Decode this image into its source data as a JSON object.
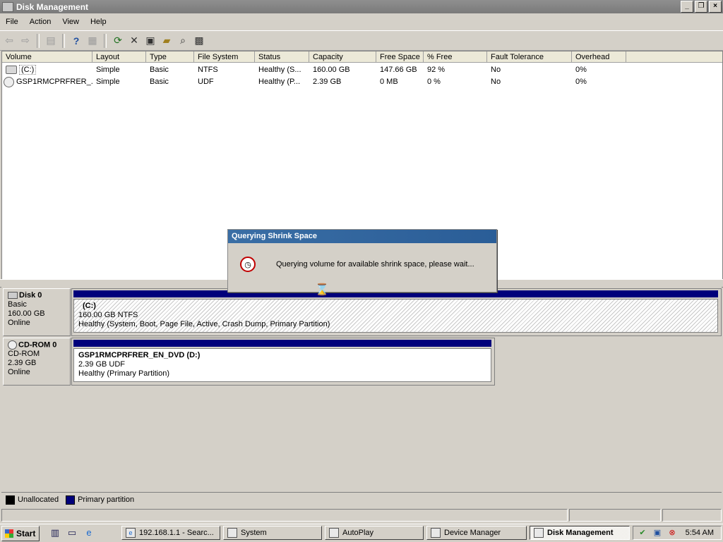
{
  "window": {
    "title": "Disk Management",
    "buttons": {
      "minimize": "_",
      "restore": "❐",
      "close": "×"
    }
  },
  "menu": [
    "File",
    "Action",
    "View",
    "Help"
  ],
  "toolbar": [
    "back-icon",
    "forward-icon",
    "console-tree-icon",
    "help-icon",
    "show-hide-icon",
    "refresh-icon",
    "delete-icon",
    "properties-icon",
    "open-icon",
    "search-icon",
    "disk-settings-icon"
  ],
  "volume_table": {
    "columns": [
      "Volume",
      "Layout",
      "Type",
      "File System",
      "Status",
      "Capacity",
      "Free Space",
      "% Free",
      "Fault Tolerance",
      "Overhead"
    ],
    "rows": [
      {
        "icon": "hard-drive-icon",
        "cells": [
          "(C:)",
          "Simple",
          "Basic",
          "NTFS",
          "Healthy (S...",
          "160.00 GB",
          "147.66 GB",
          "92 %",
          "No",
          "0%"
        ]
      },
      {
        "icon": "cd-drive-icon",
        "cells": [
          "GSP1RMCPRFRER_...",
          "Simple",
          "Basic",
          "UDF",
          "Healthy (P...",
          "2.39 GB",
          "0 MB",
          "0 %",
          "No",
          "0%"
        ]
      }
    ]
  },
  "disks": [
    {
      "name": "Disk 0",
      "type": "Basic",
      "size": "160.00 GB",
      "state": "Online",
      "partition": {
        "label": "(C:)",
        "detail": "160.00 GB NTFS",
        "status": "Healthy (System, Boot, Page File, Active, Crash Dump, Primary Partition)"
      }
    },
    {
      "name": "CD-ROM 0",
      "type": "CD-ROM",
      "size": "2.39 GB",
      "state": "Online",
      "partition": {
        "label": "GSP1RMCPRFRER_EN_DVD  (D:)",
        "detail": "2.39 GB UDF",
        "status": "Healthy (Primary Partition)"
      }
    }
  ],
  "legend": [
    {
      "label": "Unallocated",
      "color": "#000000"
    },
    {
      "label": "Primary partition",
      "color": "#00007b"
    }
  ],
  "dialog": {
    "title": "Querying Shrink Space",
    "message": "Querying volume for available shrink space, please wait..."
  },
  "taskbar": {
    "start": "Start",
    "tasks": [
      {
        "label": "192.168.1.1 - Searc...",
        "icon": "ie-icon"
      },
      {
        "label": "System",
        "icon": "system-icon"
      },
      {
        "label": "AutoPlay",
        "icon": "autoplay-icon"
      },
      {
        "label": "Device Manager",
        "icon": "device-manager-icon"
      },
      {
        "label": "Disk Management",
        "icon": "disk-management-icon",
        "active": true
      }
    ],
    "clock": "5:54 AM"
  }
}
